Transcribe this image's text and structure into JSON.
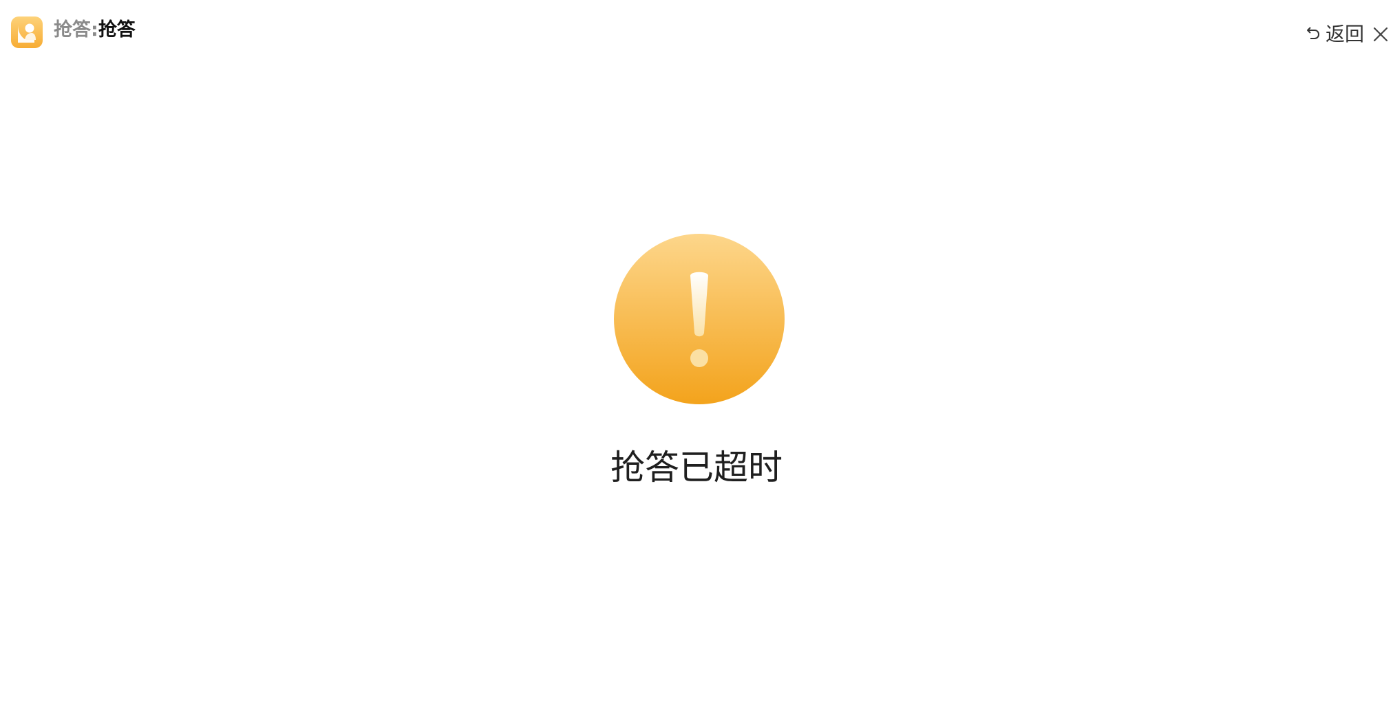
{
  "window": {
    "title_prefix": "抢答:",
    "title_name": "抢答",
    "back_label": "返回"
  },
  "icons": {
    "app": "app-logo-icon",
    "back": "undo-arrow-icon",
    "close": "close-icon",
    "status": "warning-exclamation-icon"
  },
  "colors": {
    "accent_top": "#fdd385",
    "accent_bottom": "#f4a620",
    "text": "#1f1f1f"
  },
  "main": {
    "status_message": "抢答已超时"
  }
}
